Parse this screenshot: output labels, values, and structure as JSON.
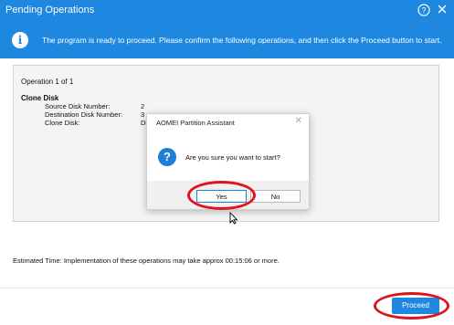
{
  "window": {
    "title": "Pending Operations",
    "help_icon": "question-icon",
    "close_icon": "close-icon"
  },
  "banner": {
    "icon": "info-icon",
    "text": "The program is ready to proceed. Please confirm the following operations, and then click the Proceed button to start."
  },
  "operations": {
    "count_label": "Operation 1 of 1",
    "items": [
      {
        "title": "Clone Disk",
        "rows": [
          {
            "label": "Source Disk Number:",
            "value": "2"
          },
          {
            "label": "Destination Disk Number:",
            "value": "3"
          },
          {
            "label": "Clone Disk:",
            "value": "Di"
          }
        ]
      }
    ]
  },
  "estimate": "Estimated Time: Implementation of these operations may take approx 00:15:06 or more.",
  "proceed_label": "Proceed",
  "dialog": {
    "title": "AOMEI Partition Assistant",
    "icon": "question-icon",
    "message": "Are you sure you want to start?",
    "yes_label": "Yes",
    "no_label": "No"
  },
  "colors": {
    "accent": "#1e88e0",
    "annotation": "#e0141e"
  }
}
